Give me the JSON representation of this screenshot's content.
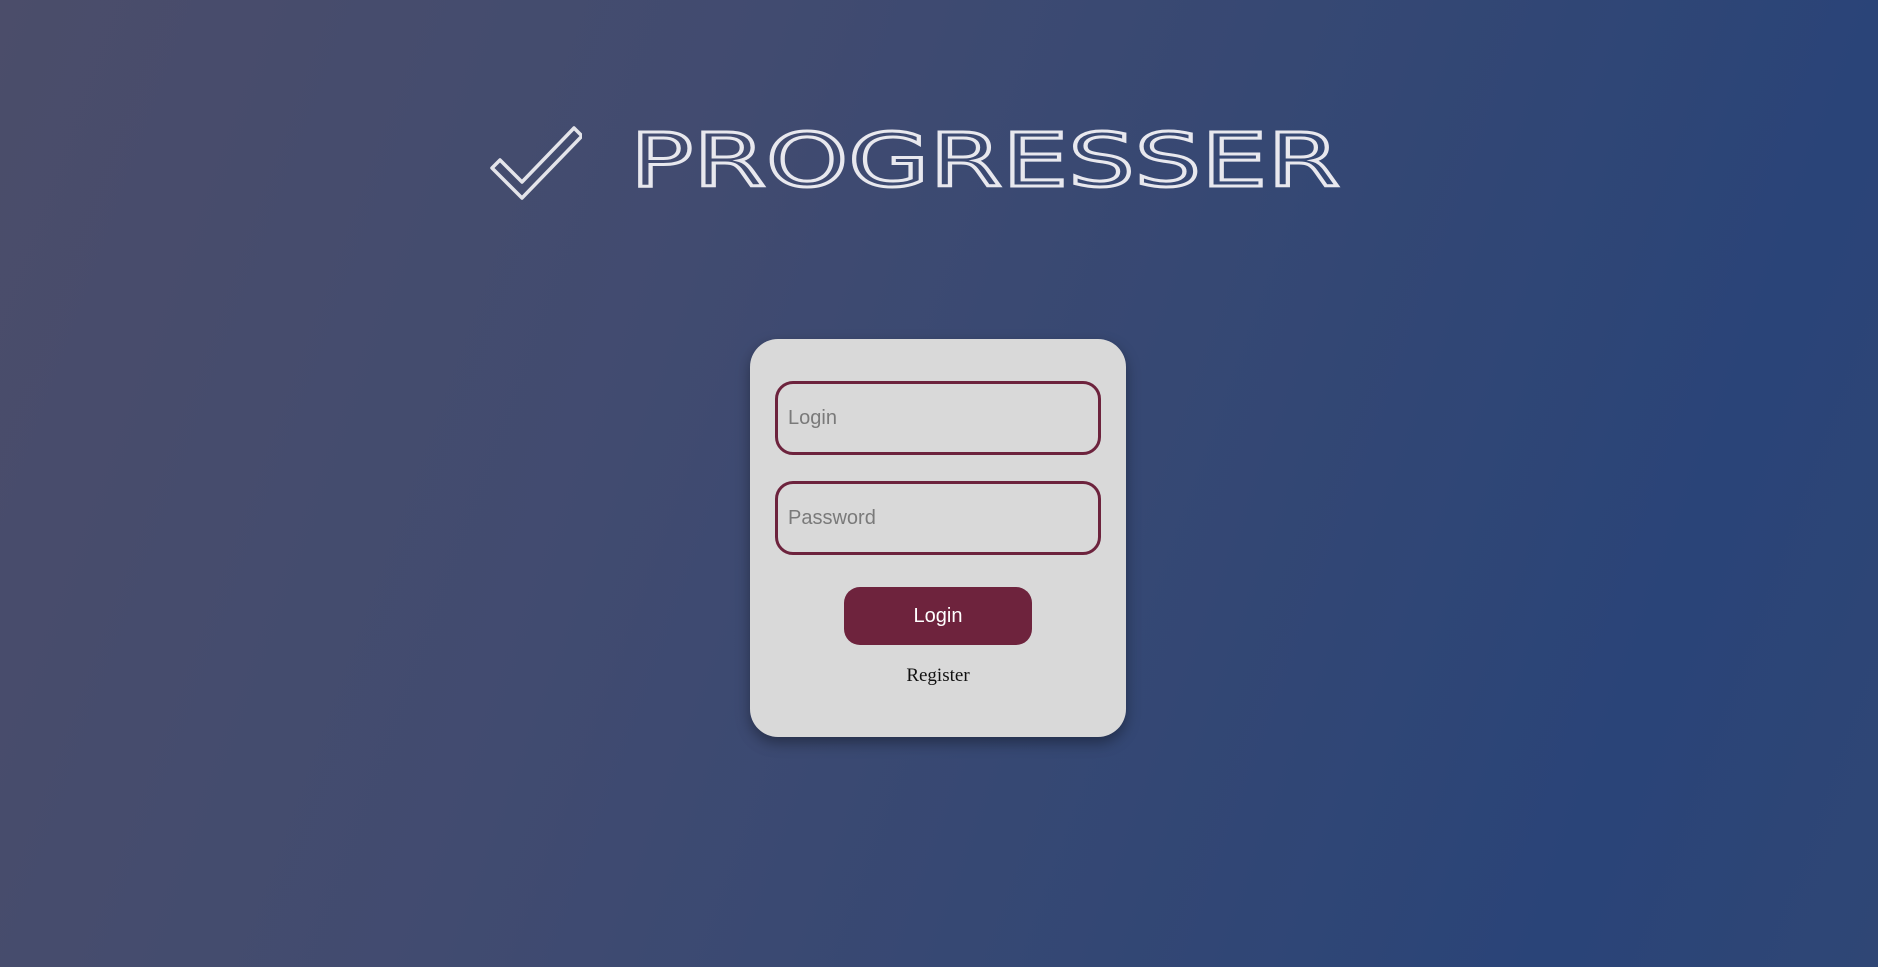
{
  "brand": {
    "name": "PROGRESSER",
    "icon": "checkmark-icon",
    "text_color": "#e8e8ee"
  },
  "form": {
    "login_placeholder": "Login",
    "password_placeholder": "Password",
    "login_button_label": "Login",
    "register_link_label": "Register"
  },
  "colors": {
    "accent": "#6e233d",
    "card_background": "#d9d9d9",
    "background_start": "#4b4d6a",
    "background_end": "#2a4478"
  }
}
